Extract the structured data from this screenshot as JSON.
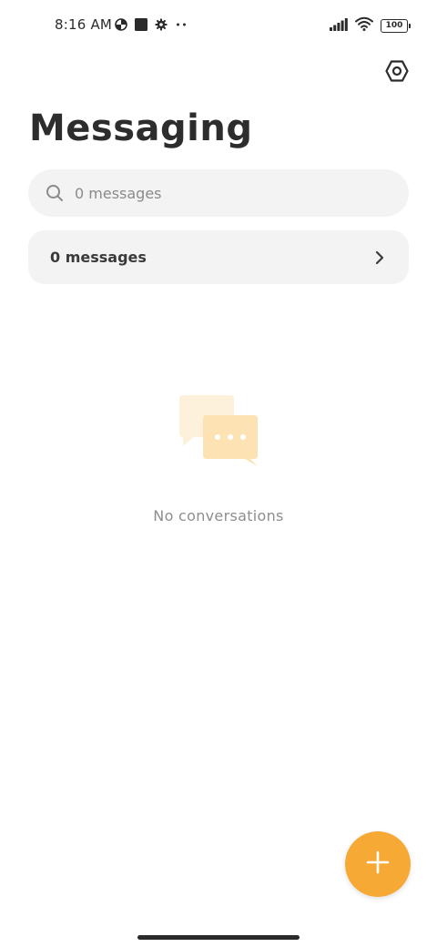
{
  "status_bar": {
    "time": "8:16 AM",
    "battery": "100",
    "left_icons": [
      "data-saver-icon",
      "square-notification-icon",
      "gear-notification-icon",
      "more-dots-icon"
    ],
    "right_icons": [
      "signal-icon",
      "wifi-icon",
      "battery-icon"
    ]
  },
  "header": {
    "title": "Messaging",
    "settings_icon": "hexagon-settings-icon"
  },
  "search": {
    "placeholder": "0 messages",
    "icon": "search-icon"
  },
  "messages_row": {
    "label": "0 messages",
    "icon": "chevron-right-icon"
  },
  "empty_state": {
    "text": "No conversations",
    "icon": "chat-bubbles-icon"
  },
  "fab": {
    "icon": "plus-icon"
  },
  "colors": {
    "accent": "#f7a935",
    "surface": "#f3f3f3",
    "text_primary": "#2d2d2d",
    "text_secondary": "#8e8e8e"
  }
}
